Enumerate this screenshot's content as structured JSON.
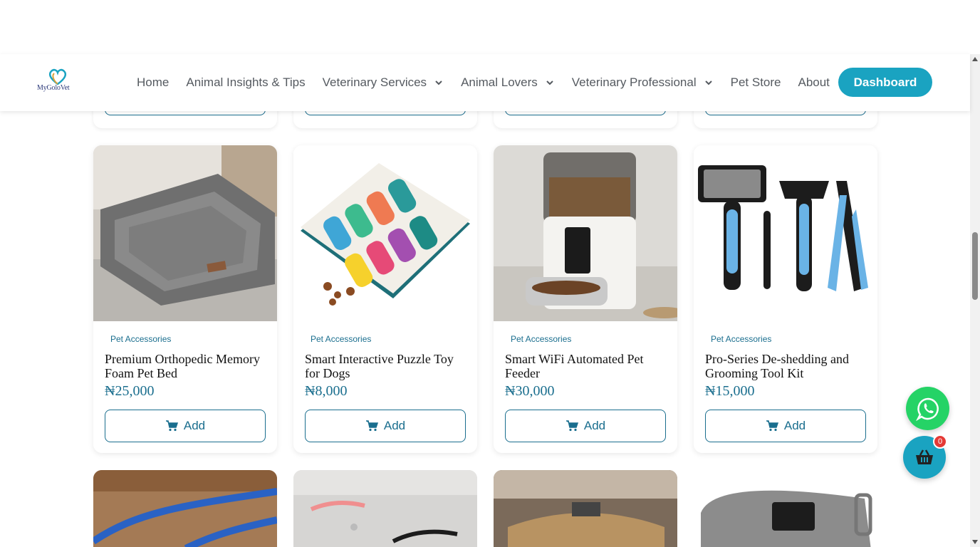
{
  "brand": {
    "name": "MyGoloVet",
    "accent": "#1aa3c1",
    "primary_text": "#1a6e8e"
  },
  "nav": {
    "items": [
      {
        "label": "Home",
        "dropdown": false
      },
      {
        "label": "Animal Insights & Tips",
        "dropdown": false
      },
      {
        "label": "Veterinary Services",
        "dropdown": true
      },
      {
        "label": "Animal Lovers",
        "dropdown": true
      },
      {
        "label": "Veterinary Professional",
        "dropdown": true
      },
      {
        "label": "Pet Store",
        "dropdown": false
      },
      {
        "label": "About",
        "dropdown": false
      }
    ],
    "dashboard_label": "Dashboard"
  },
  "products": [
    {
      "category": "Pet Accessories",
      "title": "Premium Orthopedic Memory Foam Pet Bed",
      "price": "₦25,000",
      "add_label": "Add",
      "image": "pet-bed-image"
    },
    {
      "category": "Pet Accessories",
      "title": "Smart Interactive Puzzle Toy for Dogs",
      "price": "₦8,000",
      "add_label": "Add",
      "image": "puzzle-toy-image"
    },
    {
      "category": "Pet Accessories",
      "title": "Smart WiFi Automated Pet Feeder",
      "price": "₦30,000",
      "add_label": "Add",
      "image": "pet-feeder-image"
    },
    {
      "category": "Pet Accessories",
      "title": "Pro-Series De-shedding and Grooming Tool Kit",
      "price": "₦15,000",
      "add_label": "Add",
      "image": "grooming-kit-image"
    }
  ],
  "cart": {
    "count": "0"
  },
  "icons": {
    "whatsapp": "whatsapp-icon",
    "cart": "basket-icon",
    "add": "cart-icon"
  }
}
